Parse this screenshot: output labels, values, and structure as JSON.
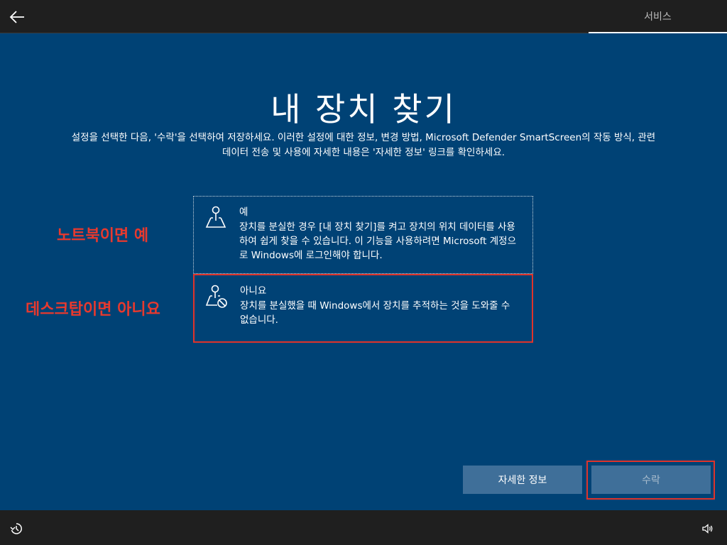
{
  "header": {
    "back_icon": "back-arrow-icon",
    "tab_label": "서비스"
  },
  "main": {
    "title": "내 장치 찾기",
    "subtitle_line1": "설정을 선택한 다음, '수락'을 선택하여 저장하세요. 이러한 설정에 대한 정보, 변경 방법, Microsoft Defender SmartScreen의 작동 방식, 관련",
    "subtitle_line2": "데이터 전송 및 사용에 자세한 내용은 '자세한 정보' 링크를 확인하세요."
  },
  "options": {
    "yes": {
      "icon": "map-pin-icon",
      "title": "예",
      "desc": "장치를 분실한 경우 [내 장치 찾기]를 켜고 장치의 위치 데이터를 사용하여 쉽게 찾을 수 있습니다. 이 기능을 사용하려면 Microsoft 계정으로 Windows에 로그인해야 합니다."
    },
    "no": {
      "icon": "map-pin-blocked-icon",
      "title": "아니요",
      "desc": "장치를 분실했을 때 Windows에서 장치를 추적하는 것을 도와줄 수 없습니다."
    }
  },
  "annotations": {
    "yes": "노트북이면 예",
    "no": "데스크탑이면 아니요"
  },
  "buttons": {
    "info": "자세한 정보",
    "accept": "수락"
  },
  "footer": {
    "ease_icon": "ease-of-access-icon",
    "volume_icon": "volume-icon"
  },
  "colors": {
    "background": "#004275",
    "bar": "#1f1f1f",
    "button": "#3f6f99",
    "highlight": "#e0332a"
  }
}
